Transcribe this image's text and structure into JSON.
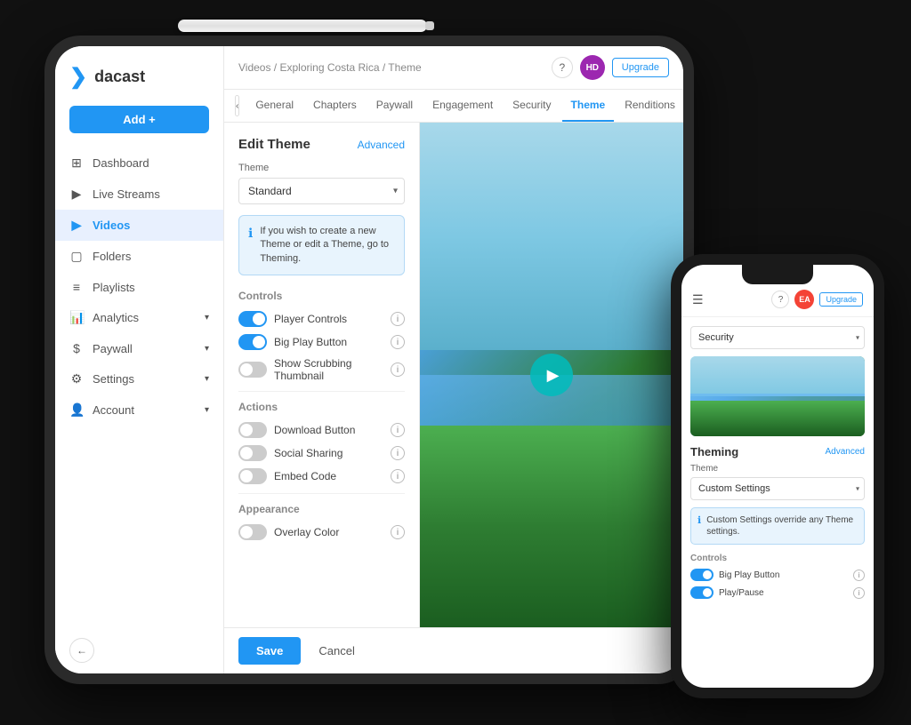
{
  "scene": {
    "bg": "#111"
  },
  "tablet": {
    "pencil_visible": true
  },
  "header": {
    "breadcrumb": "Videos / Exploring Costa Rica / Theme",
    "help_label": "?",
    "avatar_label": "HD",
    "upgrade_label": "Upgrade"
  },
  "tabs": {
    "back_label": "‹",
    "items": [
      {
        "label": "General",
        "active": false
      },
      {
        "label": "Chapters",
        "active": false
      },
      {
        "label": "Paywall",
        "active": false
      },
      {
        "label": "Engagement",
        "active": false
      },
      {
        "label": "Security",
        "active": false
      },
      {
        "label": "Theme",
        "active": true
      },
      {
        "label": "Renditions",
        "active": false
      }
    ]
  },
  "sidebar": {
    "logo": "dacast",
    "add_button": "Add +",
    "nav_items": [
      {
        "label": "Dashboard",
        "icon": "⊞",
        "active": false
      },
      {
        "label": "Live Streams",
        "icon": "▶",
        "active": false
      },
      {
        "label": "Videos",
        "icon": "▶",
        "active": true
      },
      {
        "label": "Folders",
        "icon": "▢",
        "active": false
      },
      {
        "label": "Playlists",
        "icon": "≡",
        "active": false
      },
      {
        "label": "Analytics",
        "icon": "⬡",
        "active": false,
        "arrow": "▾"
      },
      {
        "label": "Paywall",
        "icon": "$",
        "active": false,
        "arrow": "▾"
      },
      {
        "label": "Settings",
        "icon": "⚙",
        "active": false,
        "arrow": "▾"
      },
      {
        "label": "Account",
        "icon": "👤",
        "active": false,
        "arrow": "▾"
      }
    ],
    "back_icon": "←"
  },
  "edit_panel": {
    "title": "Edit Theme",
    "advanced_label": "Advanced",
    "theme_label": "Theme",
    "theme_value": "Standard",
    "info_text": "If you wish to create a new Theme or edit a Theme, go to Theming.",
    "controls_title": "Controls",
    "controls": [
      {
        "label": "Player Controls",
        "on": true
      },
      {
        "label": "Big Play Button",
        "on": true
      },
      {
        "label": "Show Scrubbing Thumbnail",
        "on": false
      }
    ],
    "actions_title": "Actions",
    "actions": [
      {
        "label": "Download Button",
        "on": false
      },
      {
        "label": "Social Sharing",
        "on": false
      },
      {
        "label": "Embed Code",
        "on": false
      }
    ],
    "appearance_title": "Appearance",
    "appearance_items": [
      {
        "label": "Overlay Color",
        "on": false
      }
    ]
  },
  "save_bar": {
    "save_label": "Save",
    "cancel_label": "Cancel"
  },
  "phone": {
    "header": {
      "menu_icon": "☰",
      "help_label": "?",
      "avatar_label": "EA",
      "upgrade_label": "Upgrade"
    },
    "security_label": "Security",
    "theming_title": "Theming",
    "advanced_label": "Advanced",
    "theme_label": "Theme",
    "theme_value": "Custom Settings",
    "info_text": "Custom Settings override any Theme settings.",
    "controls_title": "Controls",
    "controls": [
      {
        "label": "Big Play Button",
        "on": true
      },
      {
        "label": "Play/Pause",
        "on": true
      }
    ]
  }
}
